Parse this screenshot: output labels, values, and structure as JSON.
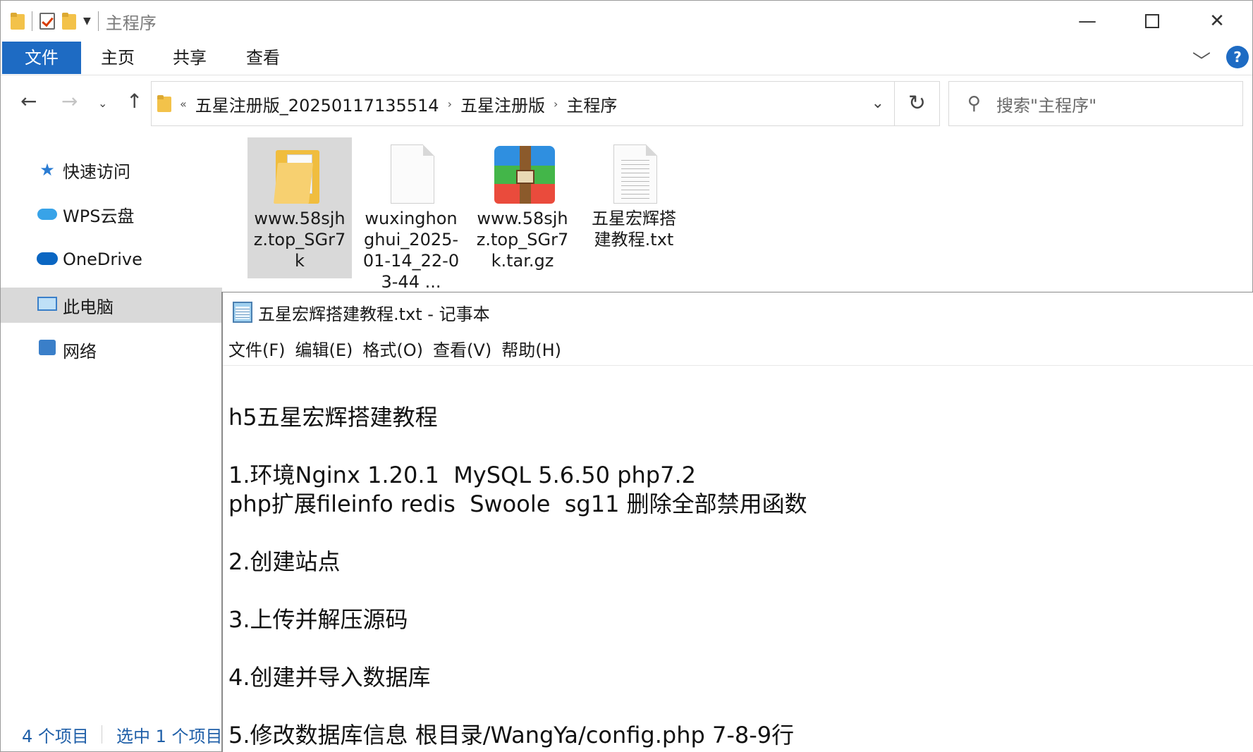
{
  "explorer": {
    "title": "主程序",
    "ribbon": {
      "tabs": [
        "文件",
        "主页",
        "共享",
        "查看"
      ],
      "help": "?"
    },
    "address": {
      "crumbs": [
        "五星注册版_20250117135514",
        "五星注册版",
        "主程序"
      ],
      "overflow": "«"
    },
    "search": {
      "placeholder": "搜索\"主程序\""
    },
    "sidebar": {
      "items": [
        "快速访问",
        "WPS云盘",
        "OneDrive",
        "此电脑",
        "网络"
      ]
    },
    "files": [
      {
        "name": "www.58sjhz.top_SGr7k",
        "type": "folder",
        "selected": true
      },
      {
        "name": "wuxinghonghui_2025-01-14_22-03-44 ...",
        "type": "file",
        "selected": false
      },
      {
        "name": "www.58sjhz.top_SGr7k.tar.gz",
        "type": "archive",
        "selected": false
      },
      {
        "name": "五星宏辉搭建教程.txt",
        "type": "text",
        "selected": false
      }
    ],
    "status": {
      "count": "4 个项目",
      "selected": "选中 1 个项目"
    }
  },
  "notepad": {
    "title": "五星宏辉搭建教程.txt - 记事本",
    "menu": [
      "文件(F)",
      "编辑(E)",
      "格式(O)",
      "查看(V)",
      "帮助(H)"
    ],
    "lines": [
      "",
      "h5五星宏辉搭建教程",
      "",
      "1.环境Nginx 1.20.1  MySQL 5.6.50 php7.2",
      "php扩展fileinfo redis  Swoole  sg11 删除全部禁用函数",
      "",
      "2.创建站点",
      "",
      "3.上传并解压源码",
      "",
      "4.创建并导入数据库",
      "",
      "5.修改数据库信息 根目录/WangYa/config.php 7-8-9行"
    ]
  }
}
